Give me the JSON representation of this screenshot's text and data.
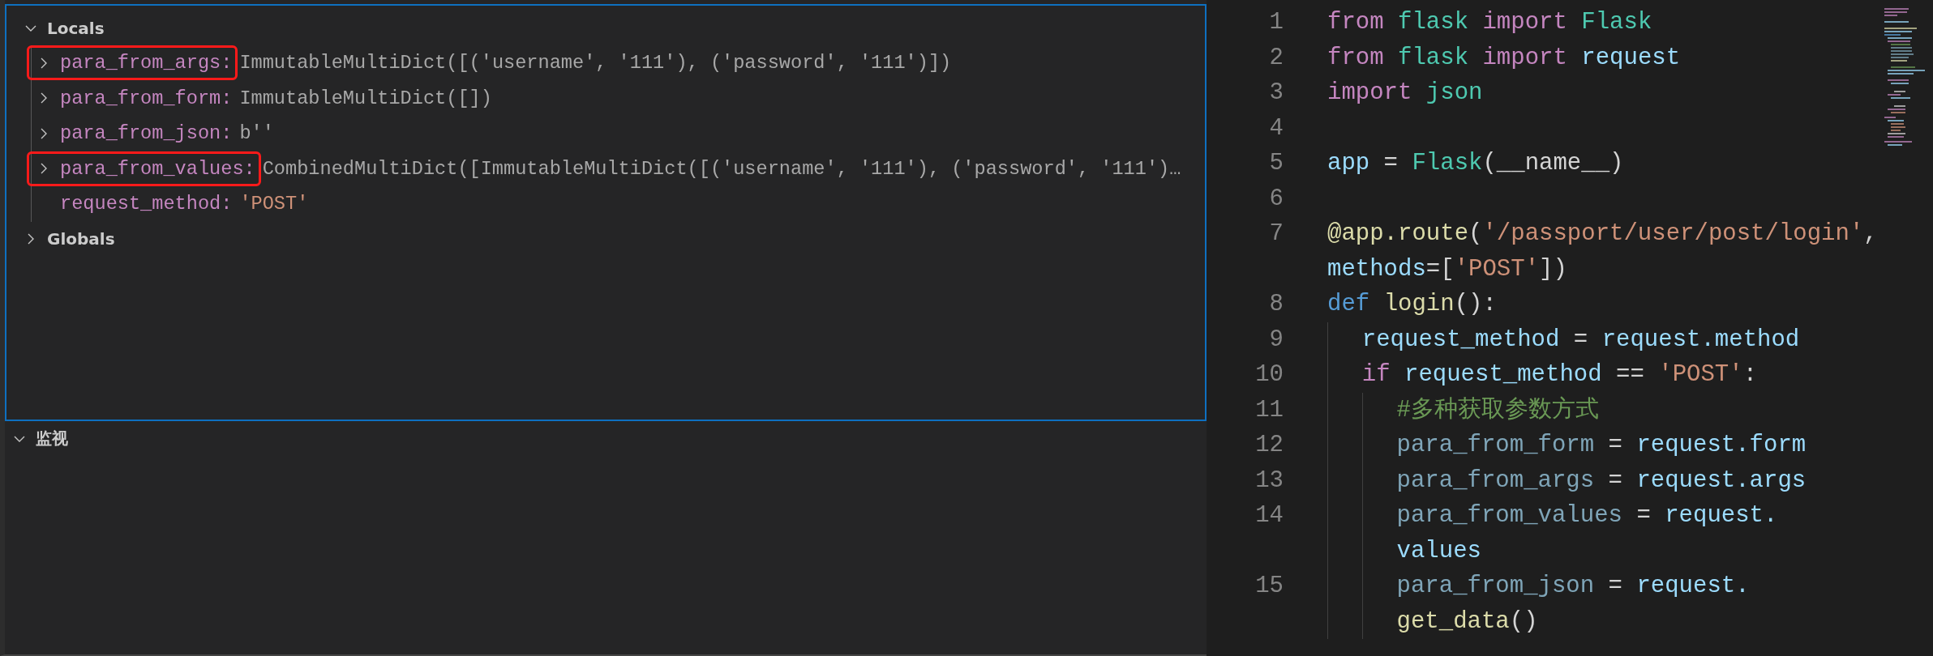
{
  "panel": {
    "sections": [
      {
        "title": "Locals",
        "expanded": true,
        "variables": [
          {
            "name": "para_from_args:",
            "value": "ImmutableMultiDict([('username', '111'), ('password', '111')])",
            "kind": "object",
            "expandable": true,
            "highlighted": true
          },
          {
            "name": "para_from_form:",
            "value": "ImmutableMultiDict([])",
            "kind": "object",
            "expandable": true,
            "highlighted": false
          },
          {
            "name": "para_from_json:",
            "value": "b''",
            "kind": "object",
            "expandable": true,
            "highlighted": false
          },
          {
            "name": "para_from_values:",
            "value": "CombinedMultiDict([ImmutableMultiDict([('username', '111'), ('password', '111')…",
            "kind": "object",
            "expandable": true,
            "highlighted": true
          },
          {
            "name": "request_method:",
            "value": "'POST'",
            "kind": "string",
            "expandable": false,
            "highlighted": false
          }
        ]
      },
      {
        "title": "Globals",
        "expanded": false
      }
    ],
    "watch": {
      "title": "监视",
      "expanded": true
    }
  },
  "editor": {
    "lines": [
      {
        "number": "1",
        "rows": [
          {
            "tokens": [
              {
                "kind": "keyword",
                "text": "from "
              },
              {
                "kind": "module",
                "text": "flask "
              },
              {
                "kind": "keyword",
                "text": "import "
              },
              {
                "kind": "module",
                "text": "Flask"
              }
            ]
          }
        ]
      },
      {
        "number": "2",
        "rows": [
          {
            "tokens": [
              {
                "kind": "keyword",
                "text": "from "
              },
              {
                "kind": "module",
                "text": "flask "
              },
              {
                "kind": "keyword",
                "text": "import "
              },
              {
                "kind": "variable",
                "text": "request"
              }
            ]
          }
        ]
      },
      {
        "number": "3",
        "rows": [
          {
            "tokens": [
              {
                "kind": "keyword",
                "text": "import "
              },
              {
                "kind": "module",
                "text": "json"
              }
            ]
          }
        ]
      },
      {
        "number": "4"
      },
      {
        "number": "5",
        "rows": [
          {
            "tokens": [
              {
                "kind": "variable",
                "text": "app"
              },
              {
                "kind": "plain",
                "text": " = "
              },
              {
                "kind": "module",
                "text": "Flask"
              },
              {
                "kind": "plain",
                "text": "(__name__)"
              }
            ]
          }
        ]
      },
      {
        "number": "6"
      },
      {
        "number": "7",
        "rows": [
          {
            "tokens": [
              {
                "kind": "function",
                "text": "@app.route"
              },
              {
                "kind": "plain",
                "text": "("
              },
              {
                "kind": "string",
                "text": "'/passport/user/post/login'"
              },
              {
                "kind": "plain",
                "text": ","
              }
            ]
          },
          {
            "tokens": [
              {
                "kind": "variable",
                "text": "methods"
              },
              {
                "kind": "plain",
                "text": "=["
              },
              {
                "kind": "string",
                "text": "'POST'"
              },
              {
                "kind": "plain",
                "text": "])"
              }
            ]
          }
        ]
      },
      {
        "number": "8",
        "rows": [
          {
            "tokens": [
              {
                "kind": "storage",
                "text": "def "
              },
              {
                "kind": "function",
                "text": "login"
              },
              {
                "kind": "plain",
                "text": "():"
              }
            ]
          }
        ]
      },
      {
        "number": "9",
        "rows": [
          {
            "tokens": [
              {
                "kind": "variable",
                "text": "    request_method"
              },
              {
                "kind": "plain",
                "text": " = "
              },
              {
                "kind": "variable",
                "text": "request.method"
              }
            ]
          }
        ]
      },
      {
        "number": "10",
        "rows": [
          {
            "tokens": [
              {
                "kind": "keyword",
                "text": "    if "
              },
              {
                "kind": "variable",
                "text": "request_method"
              },
              {
                "kind": "plain",
                "text": " == "
              },
              {
                "kind": "string",
                "text": "'POST'"
              },
              {
                "kind": "plain",
                "text": ":"
              }
            ]
          }
        ]
      },
      {
        "number": "11",
        "rows": [
          {
            "tokens": [
              {
                "kind": "comment",
                "text": "        #多种获取参数方式"
              }
            ]
          }
        ]
      },
      {
        "number": "12",
        "rows": [
          {
            "tokens": [
              {
                "kind": "unused",
                "text": "        para_from_form"
              },
              {
                "kind": "plain",
                "text": " = "
              },
              {
                "kind": "variable",
                "text": "request.form"
              }
            ]
          }
        ]
      },
      {
        "number": "13",
        "rows": [
          {
            "tokens": [
              {
                "kind": "unused",
                "text": "        para_from_args"
              },
              {
                "kind": "plain",
                "text": " = "
              },
              {
                "kind": "variable",
                "text": "request.args"
              }
            ]
          }
        ]
      },
      {
        "number": "14",
        "rows": [
          {
            "tokens": [
              {
                "kind": "unused",
                "text": "        para_from_values"
              },
              {
                "kind": "plain",
                "text": " = "
              },
              {
                "kind": "variable",
                "text": "request."
              }
            ]
          },
          {
            "tokens": [
              {
                "kind": "variable",
                "text": "        values"
              }
            ]
          }
        ]
      },
      {
        "number": "15",
        "rows": [
          {
            "tokens": [
              {
                "kind": "unused",
                "text": "        para_from_json"
              },
              {
                "kind": "plain",
                "text": " = "
              },
              {
                "kind": "variable",
                "text": "request."
              }
            ]
          },
          {
            "tokens": [
              {
                "kind": "function",
                "text": "        get_data"
              },
              {
                "kind": "plain",
                "text": "()"
              }
            ]
          }
        ]
      }
    ]
  }
}
